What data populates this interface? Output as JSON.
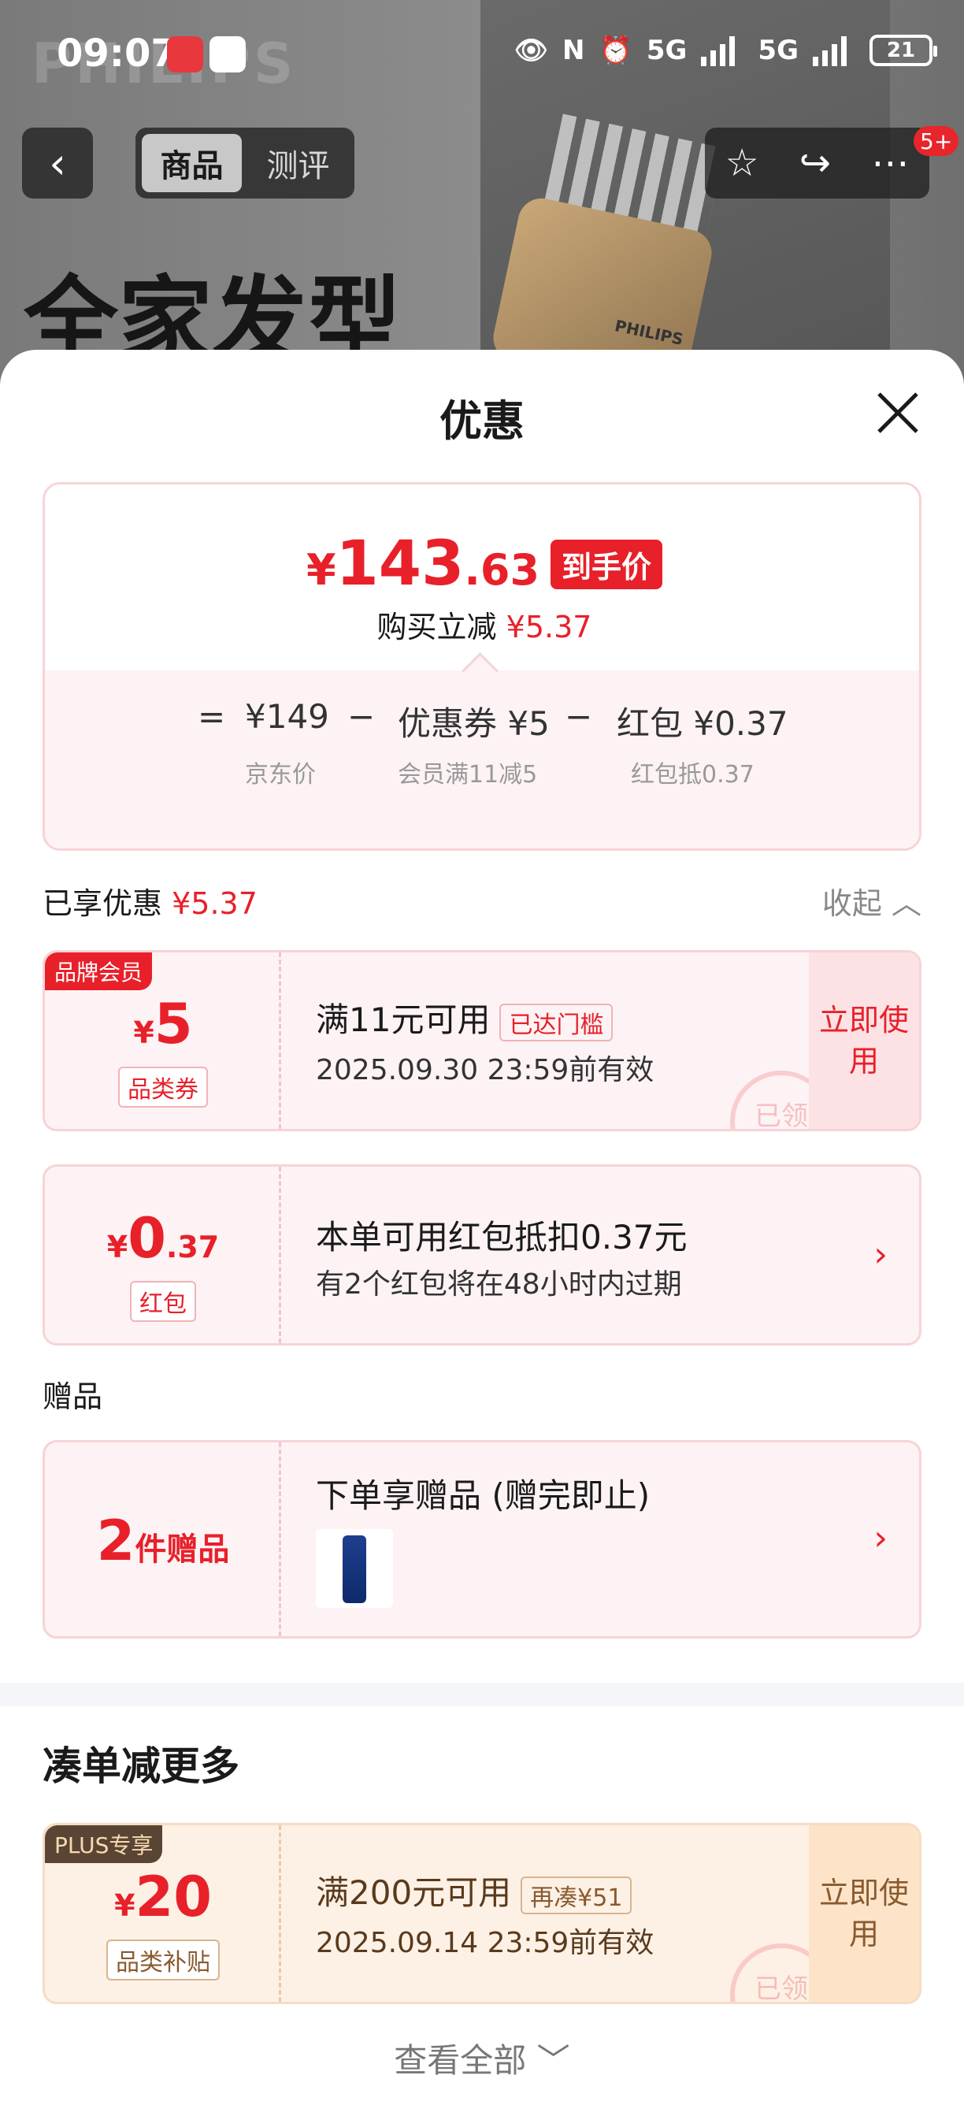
{
  "status_bar": {
    "time": "09:07",
    "network1": "5G",
    "network2": "5G",
    "battery": "21"
  },
  "background": {
    "watermark": "PHILIPS",
    "hero_title": "全家发型",
    "brand_on_device": "PHILIPS"
  },
  "nav": {
    "tabs": [
      {
        "label": "商品",
        "active": true
      },
      {
        "label": "测评",
        "active": false
      }
    ],
    "badge": "5+"
  },
  "sheet": {
    "title": "优惠",
    "price_card": {
      "currency": "¥",
      "price_int": "143",
      "price_dec": ".63",
      "tag": "到手价",
      "reduce_label": "购买立减",
      "reduce_value": "¥5.37",
      "breakdown": {
        "eq": "=",
        "jd_price": "¥149",
        "jd_price_label": "京东价",
        "minus1": "−",
        "coupon": "优惠券 ¥5",
        "coupon_label": "会员满11减5",
        "minus2": "−",
        "redpacket": "红包 ¥0.37",
        "redpacket_label": "红包抵0.37"
      }
    },
    "enjoyed": {
      "label": "已享优惠",
      "value": "¥5.37",
      "collapse": "收起"
    },
    "coupon1": {
      "corner": "品牌会员",
      "yen": "¥",
      "amount": "5",
      "kind": "品类券",
      "condition": "满11元可用",
      "status": "已达门槛",
      "expiry": "2025.09.30 23:59前有效",
      "action": "立即使用",
      "stamp": "已领"
    },
    "coupon2": {
      "yen": "¥",
      "amount_int": "0",
      "amount_dec": ".37",
      "kind": "红包",
      "condition": "本单可用红包抵扣0.37元",
      "note": "有2个红包将在48小时内过期"
    },
    "gift_section": {
      "label": "赠品"
    },
    "gift": {
      "count": "2",
      "unit": "件赠品",
      "title": "下单享赠品 (赠完即止)"
    },
    "more_section": {
      "title": "凑单减更多"
    },
    "coupon3": {
      "corner": "PLUS专享",
      "yen": "¥",
      "amount": "20",
      "kind": "品类补贴",
      "condition": "满200元可用",
      "need": "再凑¥51",
      "expiry": "2025.09.14 23:59前有效",
      "action": "立即使用",
      "stamp": "已领"
    },
    "view_all": "查看全部"
  }
}
